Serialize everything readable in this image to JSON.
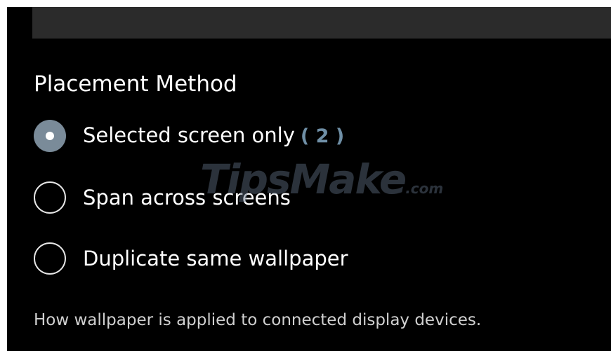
{
  "settings": {
    "section_title": "Placement Method",
    "options": [
      {
        "label": "Selected screen only",
        "count": "( 2 )",
        "selected": true
      },
      {
        "label": "Span across screens",
        "selected": false
      },
      {
        "label": "Duplicate same wallpaper",
        "selected": false
      }
    ],
    "description": "How wallpaper is applied to connected display devices."
  },
  "watermark": {
    "brand": "TipsMake",
    "suffix": ".com"
  },
  "colors": {
    "background": "#000000",
    "top_bar": "#2b2b2b",
    "accent": "#7a8b99",
    "count_text": "#6f8fa6"
  }
}
